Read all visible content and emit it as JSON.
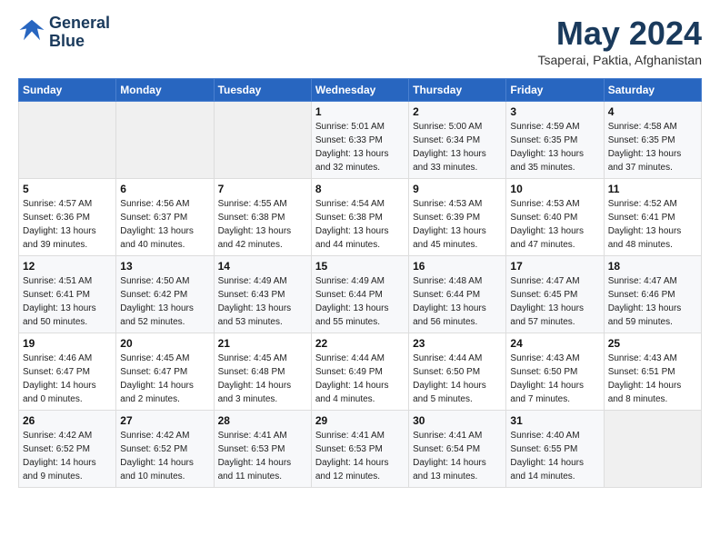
{
  "header": {
    "logo_line1": "General",
    "logo_line2": "Blue",
    "month_title": "May 2024",
    "location": "Tsaperai, Paktia, Afghanistan"
  },
  "weekdays": [
    "Sunday",
    "Monday",
    "Tuesday",
    "Wednesday",
    "Thursday",
    "Friday",
    "Saturday"
  ],
  "weeks": [
    [
      {
        "day": "",
        "info": ""
      },
      {
        "day": "",
        "info": ""
      },
      {
        "day": "",
        "info": ""
      },
      {
        "day": "1",
        "info": "Sunrise: 5:01 AM\nSunset: 6:33 PM\nDaylight: 13 hours\nand 32 minutes."
      },
      {
        "day": "2",
        "info": "Sunrise: 5:00 AM\nSunset: 6:34 PM\nDaylight: 13 hours\nand 33 minutes."
      },
      {
        "day": "3",
        "info": "Sunrise: 4:59 AM\nSunset: 6:35 PM\nDaylight: 13 hours\nand 35 minutes."
      },
      {
        "day": "4",
        "info": "Sunrise: 4:58 AM\nSunset: 6:35 PM\nDaylight: 13 hours\nand 37 minutes."
      }
    ],
    [
      {
        "day": "5",
        "info": "Sunrise: 4:57 AM\nSunset: 6:36 PM\nDaylight: 13 hours\nand 39 minutes."
      },
      {
        "day": "6",
        "info": "Sunrise: 4:56 AM\nSunset: 6:37 PM\nDaylight: 13 hours\nand 40 minutes."
      },
      {
        "day": "7",
        "info": "Sunrise: 4:55 AM\nSunset: 6:38 PM\nDaylight: 13 hours\nand 42 minutes."
      },
      {
        "day": "8",
        "info": "Sunrise: 4:54 AM\nSunset: 6:38 PM\nDaylight: 13 hours\nand 44 minutes."
      },
      {
        "day": "9",
        "info": "Sunrise: 4:53 AM\nSunset: 6:39 PM\nDaylight: 13 hours\nand 45 minutes."
      },
      {
        "day": "10",
        "info": "Sunrise: 4:53 AM\nSunset: 6:40 PM\nDaylight: 13 hours\nand 47 minutes."
      },
      {
        "day": "11",
        "info": "Sunrise: 4:52 AM\nSunset: 6:41 PM\nDaylight: 13 hours\nand 48 minutes."
      }
    ],
    [
      {
        "day": "12",
        "info": "Sunrise: 4:51 AM\nSunset: 6:41 PM\nDaylight: 13 hours\nand 50 minutes."
      },
      {
        "day": "13",
        "info": "Sunrise: 4:50 AM\nSunset: 6:42 PM\nDaylight: 13 hours\nand 52 minutes."
      },
      {
        "day": "14",
        "info": "Sunrise: 4:49 AM\nSunset: 6:43 PM\nDaylight: 13 hours\nand 53 minutes."
      },
      {
        "day": "15",
        "info": "Sunrise: 4:49 AM\nSunset: 6:44 PM\nDaylight: 13 hours\nand 55 minutes."
      },
      {
        "day": "16",
        "info": "Sunrise: 4:48 AM\nSunset: 6:44 PM\nDaylight: 13 hours\nand 56 minutes."
      },
      {
        "day": "17",
        "info": "Sunrise: 4:47 AM\nSunset: 6:45 PM\nDaylight: 13 hours\nand 57 minutes."
      },
      {
        "day": "18",
        "info": "Sunrise: 4:47 AM\nSunset: 6:46 PM\nDaylight: 13 hours\nand 59 minutes."
      }
    ],
    [
      {
        "day": "19",
        "info": "Sunrise: 4:46 AM\nSunset: 6:47 PM\nDaylight: 14 hours\nand 0 minutes."
      },
      {
        "day": "20",
        "info": "Sunrise: 4:45 AM\nSunset: 6:47 PM\nDaylight: 14 hours\nand 2 minutes."
      },
      {
        "day": "21",
        "info": "Sunrise: 4:45 AM\nSunset: 6:48 PM\nDaylight: 14 hours\nand 3 minutes."
      },
      {
        "day": "22",
        "info": "Sunrise: 4:44 AM\nSunset: 6:49 PM\nDaylight: 14 hours\nand 4 minutes."
      },
      {
        "day": "23",
        "info": "Sunrise: 4:44 AM\nSunset: 6:50 PM\nDaylight: 14 hours\nand 5 minutes."
      },
      {
        "day": "24",
        "info": "Sunrise: 4:43 AM\nSunset: 6:50 PM\nDaylight: 14 hours\nand 7 minutes."
      },
      {
        "day": "25",
        "info": "Sunrise: 4:43 AM\nSunset: 6:51 PM\nDaylight: 14 hours\nand 8 minutes."
      }
    ],
    [
      {
        "day": "26",
        "info": "Sunrise: 4:42 AM\nSunset: 6:52 PM\nDaylight: 14 hours\nand 9 minutes."
      },
      {
        "day": "27",
        "info": "Sunrise: 4:42 AM\nSunset: 6:52 PM\nDaylight: 14 hours\nand 10 minutes."
      },
      {
        "day": "28",
        "info": "Sunrise: 4:41 AM\nSunset: 6:53 PM\nDaylight: 14 hours\nand 11 minutes."
      },
      {
        "day": "29",
        "info": "Sunrise: 4:41 AM\nSunset: 6:53 PM\nDaylight: 14 hours\nand 12 minutes."
      },
      {
        "day": "30",
        "info": "Sunrise: 4:41 AM\nSunset: 6:54 PM\nDaylight: 14 hours\nand 13 minutes."
      },
      {
        "day": "31",
        "info": "Sunrise: 4:40 AM\nSunset: 6:55 PM\nDaylight: 14 hours\nand 14 minutes."
      },
      {
        "day": "",
        "info": ""
      }
    ]
  ]
}
